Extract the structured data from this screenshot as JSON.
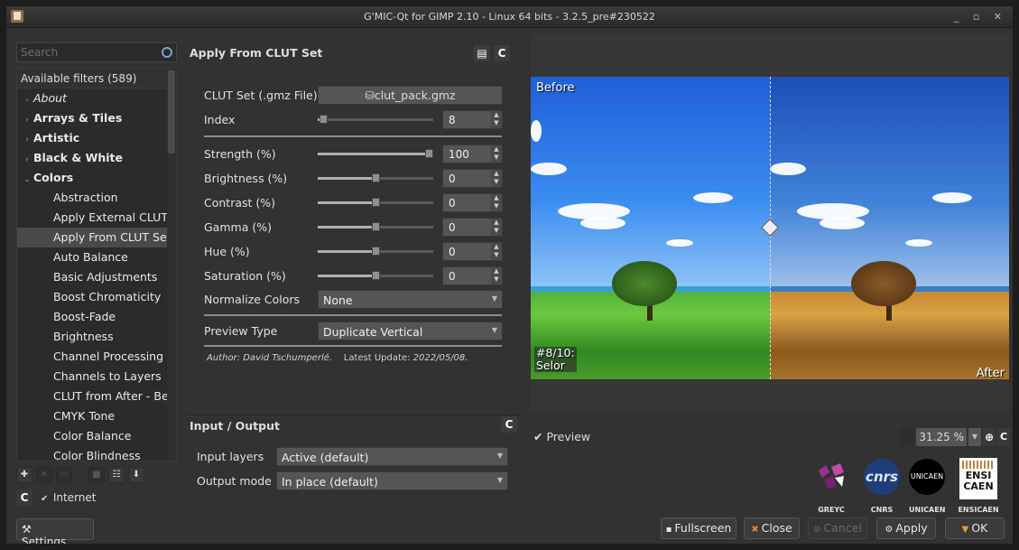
{
  "window": {
    "title": "G'MIC-Qt for GIMP 2.10 - Linux 64 bits - 3.2.5_pre#230522",
    "controls": "_ ▫ ✕"
  },
  "left": {
    "search_placeholder": "Search",
    "tree_header": "Available filters (589)",
    "tree_items": [
      {
        "label": "About",
        "kind": "about",
        "arrow": "›"
      },
      {
        "label": "Arrays & Tiles",
        "kind": "cat",
        "arrow": "›"
      },
      {
        "label": "Artistic",
        "kind": "cat",
        "arrow": "›"
      },
      {
        "label": "Black & White",
        "kind": "cat",
        "arrow": "›"
      },
      {
        "label": "Colors",
        "kind": "cat",
        "arrow": "⌄"
      },
      {
        "label": "Abstraction",
        "kind": "leaf"
      },
      {
        "label": "Apply External CLUT",
        "kind": "leaf"
      },
      {
        "label": "Apply From CLUT Set",
        "kind": "leaf",
        "selected": true
      },
      {
        "label": "Auto Balance",
        "kind": "leaf"
      },
      {
        "label": "Basic Adjustments",
        "kind": "leaf"
      },
      {
        "label": "Boost Chromaticity",
        "kind": "leaf"
      },
      {
        "label": "Boost-Fade",
        "kind": "leaf"
      },
      {
        "label": "Brightness",
        "kind": "leaf"
      },
      {
        "label": "Channel Processing",
        "kind": "leaf"
      },
      {
        "label": "Channels to Layers",
        "kind": "leaf"
      },
      {
        "label": "CLUT from After - Be",
        "kind": "leaf"
      },
      {
        "label": "CMYK Tone",
        "kind": "leaf"
      },
      {
        "label": "Color Balance",
        "kind": "leaf"
      },
      {
        "label": "Color Blindness",
        "kind": "leaf"
      }
    ],
    "internet_label": "Internet",
    "settings_label": "Settings..."
  },
  "filter": {
    "title": "Apply From CLUT Set",
    "clut_set_label": "CLUT Set (.gmz File)",
    "clut_set_value": "clut_pack.gmz",
    "index_label": "Index",
    "index_value": "8",
    "index_fraction": 0.02,
    "params": [
      {
        "label": "Strength (%)",
        "value": "100",
        "fraction": 1.0
      },
      {
        "label": "Brightness (%)",
        "value": "0",
        "fraction": 0.5
      },
      {
        "label": "Contrast (%)",
        "value": "0",
        "fraction": 0.5
      },
      {
        "label": "Gamma (%)",
        "value": "0",
        "fraction": 0.5
      },
      {
        "label": "Hue (%)",
        "value": "0",
        "fraction": 0.5
      },
      {
        "label": "Saturation (%)",
        "value": "0",
        "fraction": 0.5
      }
    ],
    "normalize_label": "Normalize Colors",
    "normalize_value": "None",
    "preview_type_label": "Preview Type",
    "preview_type_value": "Duplicate Vertical",
    "author_label": "Author:",
    "author_name": "David Tschumperlé.",
    "update_label": "Latest Update:",
    "update_date": "2022/05/08."
  },
  "io": {
    "title": "Input / Output",
    "input_label": "Input layers",
    "input_value": "Active (default)",
    "output_label": "Output mode",
    "output_value": "In place (default)"
  },
  "preview": {
    "before_label": "Before",
    "after_label": "After",
    "clut_line1": "#8/10:",
    "clut_line2": "Selor",
    "preview_label": "Preview",
    "zoom_value": "31.25 %"
  },
  "logos": {
    "greyc": "GREYC",
    "cnrs": "CNRS",
    "cnrs_mark": "cnrs",
    "unicaen": "UNICAEN",
    "unicaen_mark": "UNICAEN",
    "ensicaen": "ENSICAEN",
    "ensi_line1": "ENSI",
    "ensi_line2": "CAEN"
  },
  "buttons": {
    "fullscreen": "Fullscreen",
    "close": "Close",
    "cancel": "Cancel",
    "apply": "Apply",
    "ok": "OK"
  },
  "colors": {
    "accent": "#5a5a5a",
    "sky_before": "#1f6fe0",
    "field_before": "#3fa02a",
    "field_after": "#b07a30"
  }
}
